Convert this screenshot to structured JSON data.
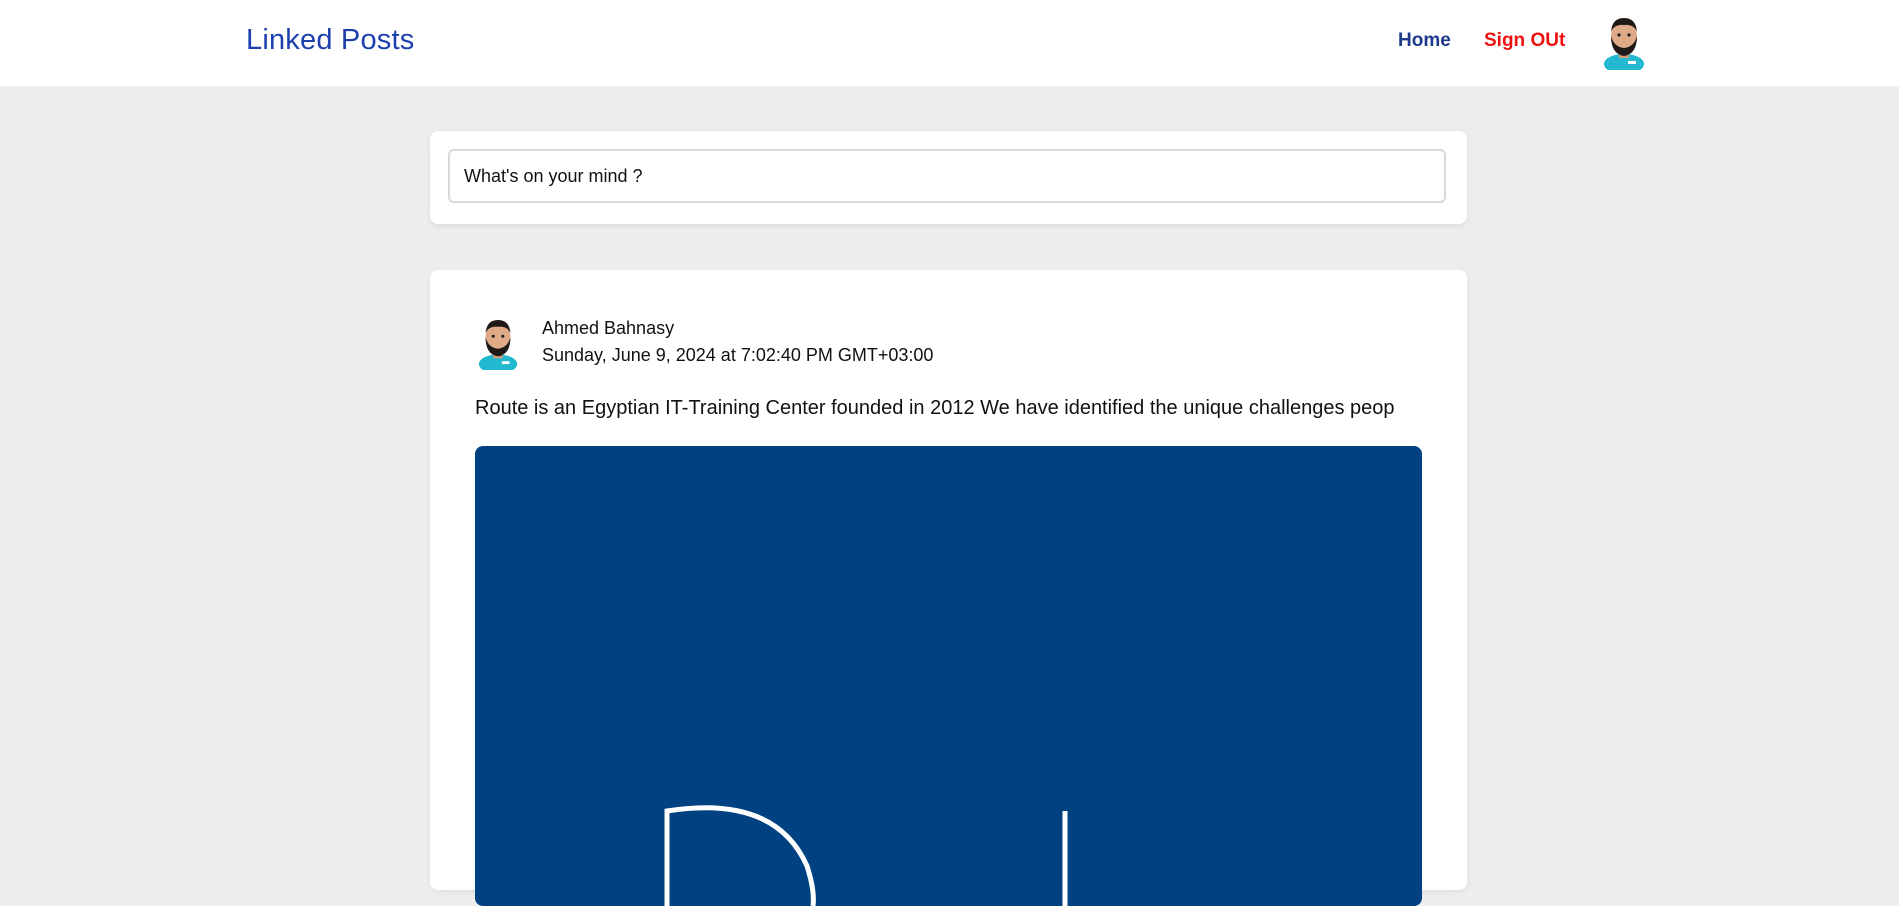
{
  "navbar": {
    "brand": "Linked Posts",
    "home_label": "Home",
    "signout_label": "Sign OUt",
    "colors": {
      "brand": "#1e40af",
      "signout": "#ef1010"
    }
  },
  "composer": {
    "placeholder": "What's on your mind ?"
  },
  "post": {
    "author": "Ahmed Bahnasy",
    "date": "Sunday, June 9, 2024 at 7:02:40 PM GMT+03:00",
    "body": "Route is an Egyptian IT-Training Center founded in 2012 We have identified the unique challenges peop",
    "image_bg": "#004182"
  },
  "icons": {
    "nav_avatar": "user-avatar-icon",
    "post_avatar": "user-avatar-icon"
  }
}
